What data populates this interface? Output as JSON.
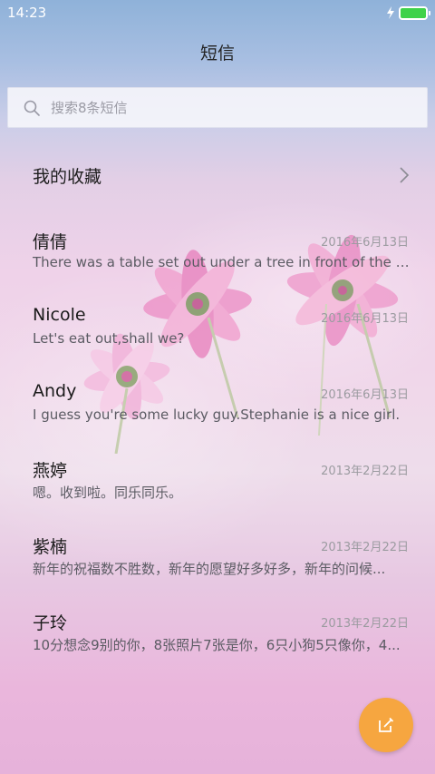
{
  "status_bar": {
    "time": "14:23",
    "icons": [
      "charging-icon",
      "battery-icon"
    ],
    "battery_color": "#3fd24a"
  },
  "header": {
    "title": "短信"
  },
  "search": {
    "placeholder": "搜索8条短信"
  },
  "favorites": {
    "label": "我的收藏"
  },
  "messages": [
    {
      "name": "倩倩",
      "date": "2016年6月13日",
      "preview": "There was a table set out under a tree in front of the ho..."
    },
    {
      "name": "Nicole",
      "date": "2016年6月13日",
      "preview": "Let's eat out,shall we?"
    },
    {
      "name": "Andy",
      "date": "2016年6月13日",
      "preview": "I guess you're some lucky guy.Stephanie is a nice girl."
    },
    {
      "name": "燕婷",
      "date": "2013年2月22日",
      "preview": "嗯。收到啦。同乐同乐。"
    },
    {
      "name": "紫楠",
      "date": "2013年2月22日",
      "preview": "新年的祝福数不胜数，新年的愿望好多好多，新年的问候..."
    },
    {
      "name": "子玲",
      "date": "2013年2月22日",
      "preview": "10分想念9别的你，8张照片7张是你，6只小狗5只像你，4..."
    }
  ],
  "fab": {
    "icon": "compose-icon",
    "color": "#f6a640"
  }
}
